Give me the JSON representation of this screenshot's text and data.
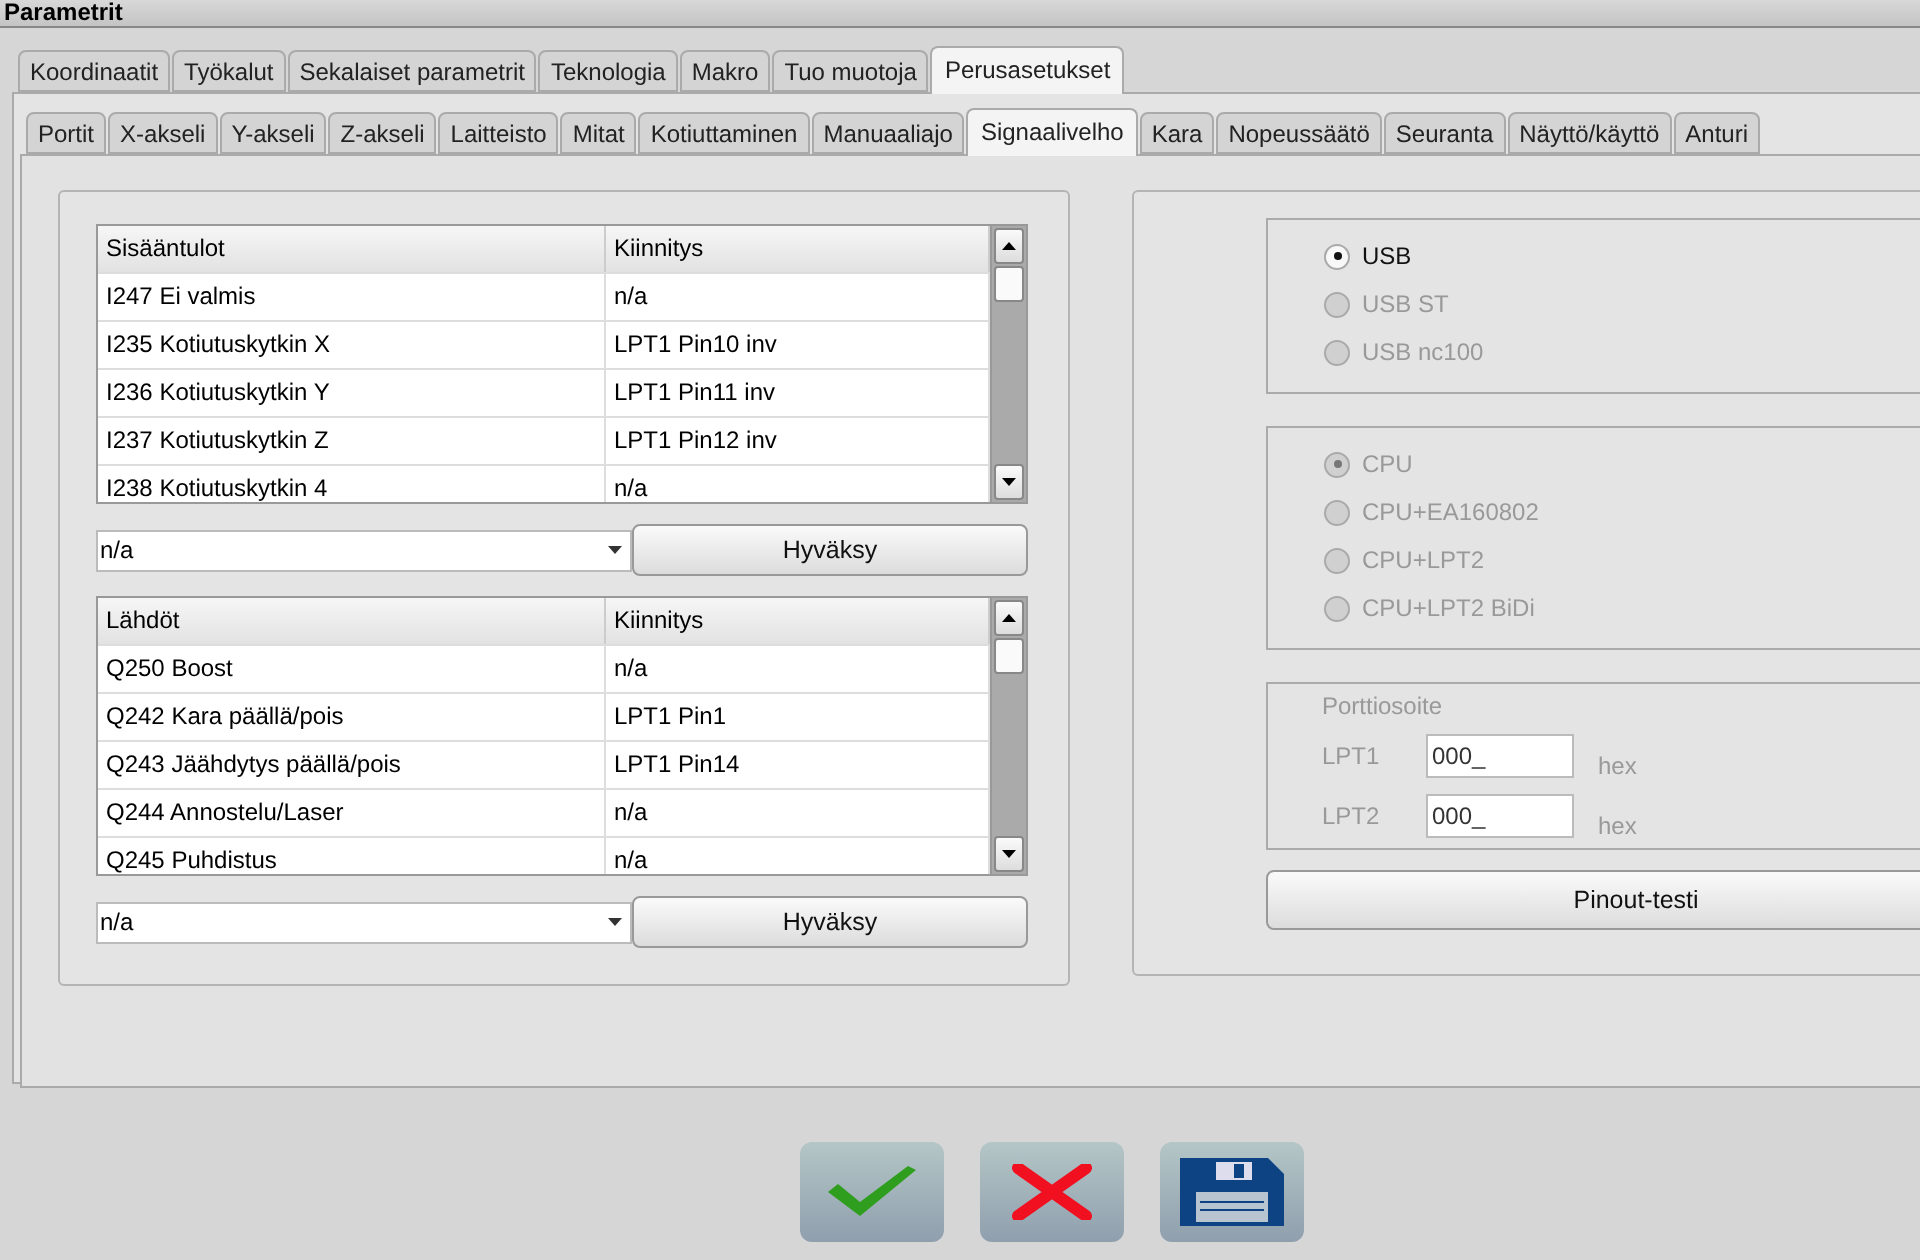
{
  "window": {
    "title": "Parametrit"
  },
  "tabs": [
    {
      "label": "Koordinaatit",
      "selected": false
    },
    {
      "label": "Työkalut",
      "selected": false
    },
    {
      "label": "Sekalaiset parametrit",
      "selected": false
    },
    {
      "label": "Teknologia",
      "selected": false
    },
    {
      "label": "Makro",
      "selected": false
    },
    {
      "label": "Tuo muotoja",
      "selected": false
    },
    {
      "label": "Perusasetukset",
      "selected": true
    }
  ],
  "subtabs": [
    {
      "label": "Portit",
      "selected": false
    },
    {
      "label": "X-akseli",
      "selected": false
    },
    {
      "label": "Y-akseli",
      "selected": false
    },
    {
      "label": "Z-akseli",
      "selected": false
    },
    {
      "label": "Laitteisto",
      "selected": false
    },
    {
      "label": "Mitat",
      "selected": false
    },
    {
      "label": "Kotiuttaminen",
      "selected": false
    },
    {
      "label": "Manuaaliajo",
      "selected": false
    },
    {
      "label": "Signaalivelho",
      "selected": true
    },
    {
      "label": "Kara",
      "selected": false
    },
    {
      "label": "Nopeussäätö",
      "selected": false
    },
    {
      "label": "Seuranta",
      "selected": false
    },
    {
      "label": "Näyttö/käyttö",
      "selected": false
    },
    {
      "label": "Anturi",
      "selected": false
    }
  ],
  "tables": [
    {
      "columns": [
        "Sisääntulot",
        "Kiinnitys"
      ],
      "rows": [
        [
          "I247 Ei valmis",
          "n/a"
        ],
        [
          "I235 Kotiutuskytkin X",
          "LPT1 Pin10 inv"
        ],
        [
          "I236 Kotiutuskytkin Y",
          "LPT1 Pin11 inv"
        ],
        [
          "I237 Kotiutuskytkin Z",
          "LPT1 Pin12 inv"
        ],
        [
          "I238 Kotiutuskytkin 4",
          "n/a"
        ]
      ],
      "combo": {
        "value": "n/a"
      },
      "button": "Hyväksy"
    },
    {
      "columns": [
        "Lähdöt",
        "Kiinnitys"
      ],
      "rows": [
        [
          "Q250 Boost",
          "n/a"
        ],
        [
          "Q242 Kara päällä/pois",
          "LPT1 Pin1"
        ],
        [
          "Q243 Jäähdytys päällä/pois",
          "LPT1 Pin14"
        ],
        [
          "Q244 Annostelu/Laser",
          "n/a"
        ],
        [
          "Q245 Puhdistus",
          "n/a"
        ]
      ],
      "combo": {
        "value": "n/a"
      },
      "button": "Hyväksy"
    }
  ],
  "radio_groups": [
    [
      {
        "label": "USB",
        "selected": true,
        "disabled": false
      },
      {
        "label": "USB ST",
        "selected": false,
        "disabled": true
      },
      {
        "label": "USB nc100",
        "selected": false,
        "disabled": true
      }
    ],
    [
      {
        "label": "CPU",
        "selected": true,
        "disabled": true
      },
      {
        "label": "CPU+EA160802",
        "selected": false,
        "disabled": true
      },
      {
        "label": "CPU+LPT2",
        "selected": false,
        "disabled": true
      },
      {
        "label": "CPU+LPT2 BiDi",
        "selected": false,
        "disabled": true
      }
    ]
  ],
  "port_address": {
    "title": "Porttiosoite",
    "fields": [
      {
        "label": "LPT1",
        "value": "000_",
        "unit": "hex"
      },
      {
        "label": "LPT2",
        "value": "000_",
        "unit": "hex"
      }
    ]
  },
  "pinout_button": "Pinout-testi",
  "footer_buttons": [
    {
      "kind": "ok"
    },
    {
      "kind": "cancel"
    },
    {
      "kind": "save"
    }
  ]
}
